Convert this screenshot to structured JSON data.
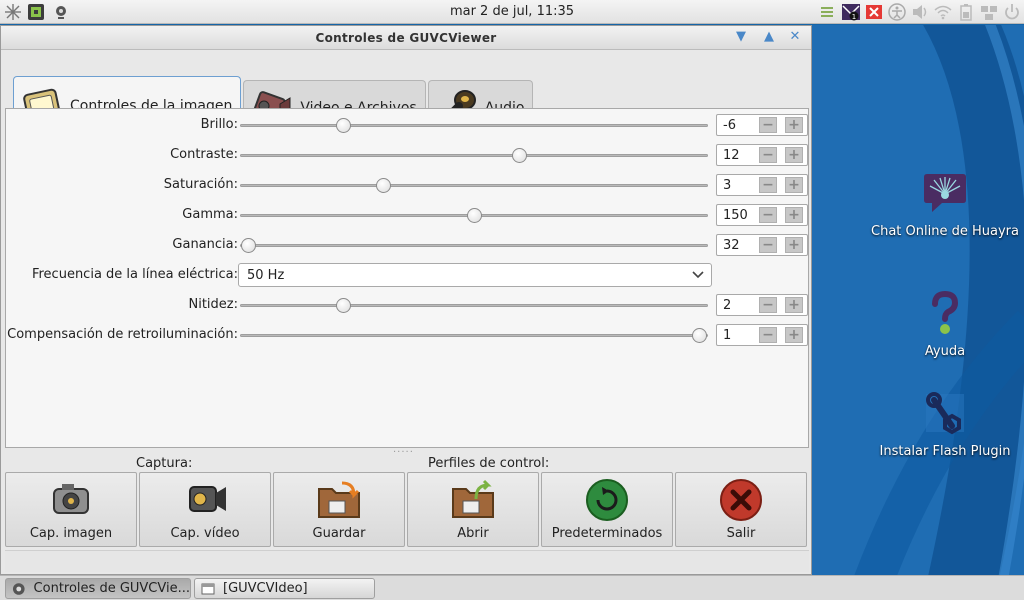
{
  "top_panel": {
    "clock": "mar  2 de jul, 11:35",
    "notification_count": "1"
  },
  "window": {
    "title": "Controles de GUVCViewer",
    "tabs": [
      {
        "label": "Controles de la imagen",
        "icon": "camera-icon",
        "active": true
      },
      {
        "label": "Video e Archivos",
        "icon": "film-camera-icon",
        "active": false
      },
      {
        "label": "Audio",
        "icon": "microphone-icon",
        "active": false
      }
    ],
    "controls": {
      "brillo": {
        "label": "Brillo:",
        "value": "-6",
        "position": 0.21
      },
      "contraste": {
        "label": "Contraste:",
        "value": "12",
        "position": 0.6
      },
      "saturacion": {
        "label": "Saturación:",
        "value": "3",
        "position": 0.3
      },
      "gamma": {
        "label": "Gamma:",
        "value": "150",
        "position": 0.5
      },
      "ganancia": {
        "label": "Ganancia:",
        "value": "32",
        "position": 0.0
      },
      "frecuencia": {
        "label": "Frecuencia de la línea eléctrica:",
        "value": "50 Hz"
      },
      "nitidez": {
        "label": "Nitidez:",
        "value": "2",
        "position": 0.21
      },
      "retroiluminacion": {
        "label": "Compensación de retroiluminación:",
        "value": "1",
        "position": 1.0
      }
    },
    "spin_minus": "−",
    "spin_plus": "+",
    "sections": {
      "captura": "Captura:",
      "perfiles": "Perfiles de control:"
    },
    "buttons": {
      "cap_imagen": "Cap. imagen",
      "cap_video": "Cap. vídeo",
      "guardar": "Guardar",
      "abrir": "Abrir",
      "predeterminados": "Predeterminados",
      "salir": "Salir"
    }
  },
  "desktop": {
    "icons": {
      "chat": "Chat Online de Huayra",
      "ayuda": "Ayuda",
      "flash": "Instalar Flash Plugin"
    }
  },
  "taskbar": {
    "items": {
      "guvc_controls": "Controles de GUVCVie...",
      "guvc_video": "[GUVCVIdeo]"
    }
  },
  "colors": {
    "desktop_bg": "#1f6db3",
    "accent": "#4a88c8",
    "exit_red": "#c0392b",
    "reset_green": "#2e8b3e"
  }
}
